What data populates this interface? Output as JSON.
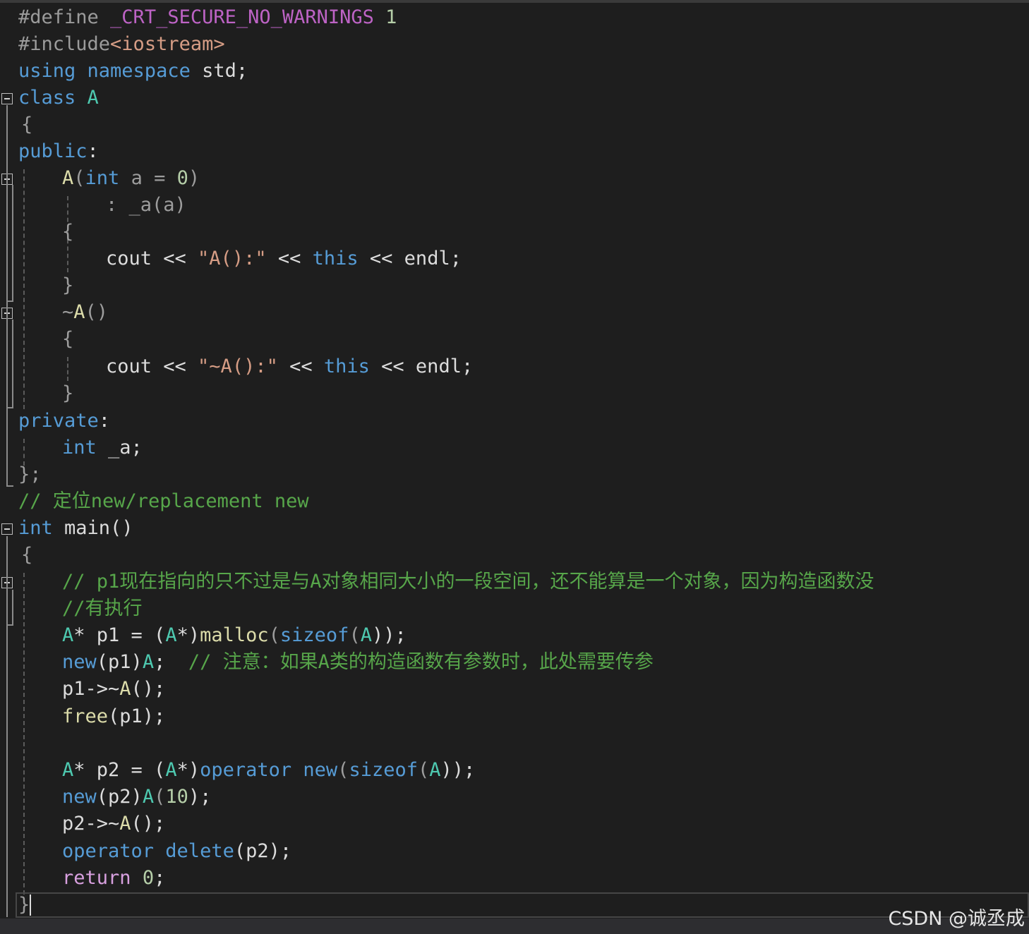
{
  "code": {
    "l1": {
      "a": "#define ",
      "b": "_CRT_SECURE_NO_WARNINGS",
      "c": " 1"
    },
    "l2": {
      "a": "#include",
      "b": "<iostream>"
    },
    "l3": {
      "a": "using namespace",
      "b": " std;"
    },
    "l4": {
      "a": "class",
      "b": " A"
    },
    "l5": {
      "a": "{"
    },
    "l6": {
      "a": "public",
      "b": ":"
    },
    "l7": {
      "a": "A",
      "b": "(",
      "c": "int",
      "d": " a = ",
      "e": "0",
      "f": ")"
    },
    "l8": {
      "a": ": _a(a)"
    },
    "l9": {
      "a": "{"
    },
    "l10": {
      "a": "cout << ",
      "b": "\"A():\"",
      "c": " << ",
      "d": "this",
      "e": " << endl;"
    },
    "l11": {
      "a": "}"
    },
    "l12": {
      "a": "~",
      "b": "A",
      "c": "()"
    },
    "l13": {
      "a": "{"
    },
    "l14": {
      "a": "cout << ",
      "b": "\"~A():\"",
      "c": " << ",
      "d": "this",
      "e": " << endl;"
    },
    "l15": {
      "a": "}"
    },
    "l16": {
      "a": "private",
      "b": ":"
    },
    "l17": {
      "a": "int",
      "b": " _a;"
    },
    "l18": {
      "a": "};"
    },
    "l19": {
      "a": "// 定位new/replacement new"
    },
    "l20": {
      "a": "int",
      "b": " main()"
    },
    "l21": {
      "a": "{"
    },
    "l22": {
      "a": "// p1现在指向的只不过是与A对象相同大小的一段空间，还不能算是一个对象，因为构造函数没"
    },
    "l23": {
      "a": "//有执行"
    },
    "l24": {
      "a": "A",
      "b": "* p1 = (",
      "c": "A",
      "d": "*)",
      "e": "malloc",
      "f": "(",
      "g": "sizeof",
      "h": "(",
      "i": "A",
      "j": "));"
    },
    "l25": {
      "a": "new",
      "b": "(p1)",
      "c": "A",
      "d": ";  ",
      "e": "// 注意：如果A类的构造函数有参数时，此处需要传参"
    },
    "l26": {
      "a": "p1->~",
      "b": "A",
      "c": "();"
    },
    "l27": {
      "a": "free",
      "b": "(p1);"
    },
    "l28": {
      "a": "A",
      "b": "* p2 = (",
      "c": "A",
      "d": "*)",
      "e": "operator new",
      "f": "(",
      "g": "sizeof",
      "h": "(",
      "i": "A",
      "j": "));"
    },
    "l29": {
      "a": "new",
      "b": "(p2)",
      "c": "A",
      "d": "(",
      "e": "10",
      "f": ");"
    },
    "l30": {
      "a": "p2->~",
      "b": "A",
      "c": "();"
    },
    "l31": {
      "a": "operator delete",
      "b": "(p2);"
    },
    "l32": {
      "a": "return",
      "b": " ",
      "c": "0",
      "d": ";"
    },
    "l33": {
      "a": "}"
    }
  },
  "watermark": "CSDN @诚丞成",
  "colors": {
    "background": "#1e1e1e",
    "keyword": "#569cd6",
    "type": "#4ec9b0",
    "function": "#dcdcaa",
    "string": "#d69d85",
    "comment": "#57a64a",
    "macro": "#bd63c5",
    "control": "#d8a0df"
  }
}
